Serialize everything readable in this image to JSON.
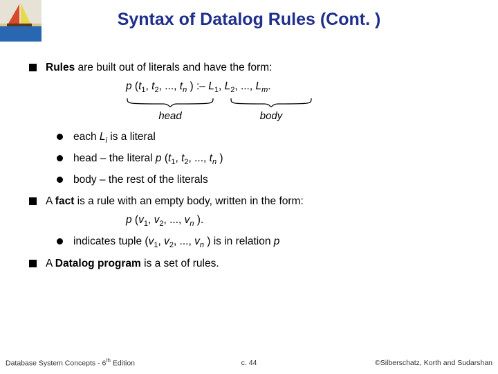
{
  "title": "Syntax of Datalog Rules (Cont. )",
  "corner_alt": "sailboat-image",
  "bullets": {
    "b1_pre": "Rules",
    "b1_post": " are built out of literals and have the form:",
    "brace_head": "head",
    "brace_body": "body",
    "b1a_pre": "each ",
    "b1a_li": "L",
    "b1a_sub": "i",
    "b1a_post": " is a literal",
    "b1b": "head – the literal ",
    "b1c": "body – the rest of the literals",
    "b2_pre": "A ",
    "b2_fact": "fact",
    "b2_post": " is a rule with an empty body, written in the form:",
    "b2a_pre": "indicates tuple (",
    "b2a_mid1": ", ",
    "b2a_mid2": ", ..., ",
    "b2a_post": " ) is in relation ",
    "b3_pre": "A ",
    "b3_prog": "Datalog program",
    "b3_post": " is a set of rules."
  },
  "formula": {
    "p": "p",
    "t": "t",
    "L": "L",
    "v": "v",
    "n": "n",
    "m": "m",
    "one": "1",
    "two": "2",
    "dots": ", ..., ",
    "sep": ", ",
    "colon_dash": " :– ",
    "open": " (",
    "close": " )",
    "close_dot": " ).",
    "dot": "."
  },
  "footer": {
    "left_pre": "Database System Concepts - 6",
    "left_sup": "th",
    "left_post": " Edition",
    "center": "c. 44",
    "right": "©Silberschatz, Korth and Sudarshan"
  }
}
